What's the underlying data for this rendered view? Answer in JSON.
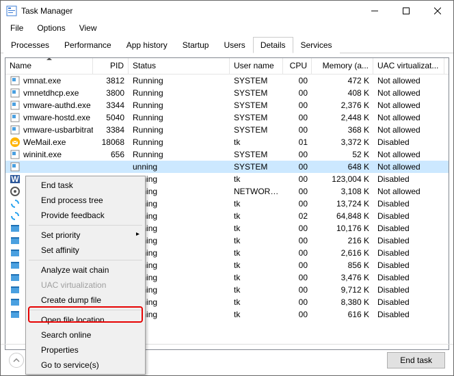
{
  "window": {
    "title": "Task Manager"
  },
  "menu": {
    "file": "File",
    "options": "Options",
    "view": "View"
  },
  "tabs": {
    "items": [
      "Processes",
      "Performance",
      "App history",
      "Startup",
      "Users",
      "Details",
      "Services"
    ],
    "active": 5
  },
  "columns": {
    "name": "Name",
    "pid": "PID",
    "status": "Status",
    "user": "User name",
    "cpu": "CPU",
    "mem": "Memory (a...",
    "uac": "UAC virtualizat..."
  },
  "rows": [
    {
      "icon": "exe",
      "name": "vmnat.exe",
      "pid": "3812",
      "status": "Running",
      "user": "SYSTEM",
      "cpu": "00",
      "mem": "472 K",
      "uac": "Not allowed",
      "sel": false
    },
    {
      "icon": "exe",
      "name": "vmnetdhcp.exe",
      "pid": "3800",
      "status": "Running",
      "user": "SYSTEM",
      "cpu": "00",
      "mem": "408 K",
      "uac": "Not allowed",
      "sel": false
    },
    {
      "icon": "exe",
      "name": "vmware-authd.exe",
      "pid": "3344",
      "status": "Running",
      "user": "SYSTEM",
      "cpu": "00",
      "mem": "2,376 K",
      "uac": "Not allowed",
      "sel": false
    },
    {
      "icon": "exe",
      "name": "vmware-hostd.exe",
      "pid": "5040",
      "status": "Running",
      "user": "SYSTEM",
      "cpu": "00",
      "mem": "2,448 K",
      "uac": "Not allowed",
      "sel": false
    },
    {
      "icon": "exe",
      "name": "vmware-usbarbitrat...",
      "pid": "3384",
      "status": "Running",
      "user": "SYSTEM",
      "cpu": "00",
      "mem": "368 K",
      "uac": "Not allowed",
      "sel": false
    },
    {
      "icon": "wemail",
      "name": "WeMail.exe",
      "pid": "18068",
      "status": "Running",
      "user": "tk",
      "cpu": "01",
      "mem": "3,372 K",
      "uac": "Disabled",
      "sel": false
    },
    {
      "icon": "exe",
      "name": "wininit.exe",
      "pid": "656",
      "status": "Running",
      "user": "SYSTEM",
      "cpu": "00",
      "mem": "52 K",
      "uac": "Not allowed",
      "sel": false
    },
    {
      "icon": "exe",
      "name": "",
      "pid": "",
      "status": "unning",
      "user": "SYSTEM",
      "cpu": "00",
      "mem": "648 K",
      "uac": "Not allowed",
      "sel": true
    },
    {
      "icon": "word",
      "name": "",
      "pid": "",
      "status": "unning",
      "user": "tk",
      "cpu": "00",
      "mem": "123,004 K",
      "uac": "Disabled",
      "sel": false
    },
    {
      "icon": "svc",
      "name": "",
      "pid": "",
      "status": "unning",
      "user": "NETWORK...",
      "cpu": "00",
      "mem": "3,108 K",
      "uac": "Not allowed",
      "sel": false
    },
    {
      "icon": "sync",
      "name": "",
      "pid": "",
      "status": "unning",
      "user": "tk",
      "cpu": "00",
      "mem": "13,724 K",
      "uac": "Disabled",
      "sel": false
    },
    {
      "icon": "sync",
      "name": "",
      "pid": "",
      "status": "unning",
      "user": "tk",
      "cpu": "02",
      "mem": "64,848 K",
      "uac": "Disabled",
      "sel": false
    },
    {
      "icon": "win",
      "name": "",
      "pid": "",
      "status": "unning",
      "user": "tk",
      "cpu": "00",
      "mem": "10,176 K",
      "uac": "Disabled",
      "sel": false
    },
    {
      "icon": "win",
      "name": "",
      "pid": "",
      "status": "unning",
      "user": "tk",
      "cpu": "00",
      "mem": "216 K",
      "uac": "Disabled",
      "sel": false
    },
    {
      "icon": "win",
      "name": "",
      "pid": "",
      "status": "unning",
      "user": "tk",
      "cpu": "00",
      "mem": "2,616 K",
      "uac": "Disabled",
      "sel": false
    },
    {
      "icon": "win",
      "name": "",
      "pid": "",
      "status": "unning",
      "user": "tk",
      "cpu": "00",
      "mem": "856 K",
      "uac": "Disabled",
      "sel": false
    },
    {
      "icon": "win",
      "name": "",
      "pid": "",
      "status": "unning",
      "user": "tk",
      "cpu": "00",
      "mem": "3,476 K",
      "uac": "Disabled",
      "sel": false
    },
    {
      "icon": "win",
      "name": "",
      "pid": "",
      "status": "unning",
      "user": "tk",
      "cpu": "00",
      "mem": "9,712 K",
      "uac": "Disabled",
      "sel": false
    },
    {
      "icon": "win",
      "name": "",
      "pid": "",
      "status": "unning",
      "user": "tk",
      "cpu": "00",
      "mem": "8,380 K",
      "uac": "Disabled",
      "sel": false
    },
    {
      "icon": "win",
      "name": "",
      "pid": "",
      "status": "unning",
      "user": "tk",
      "cpu": "00",
      "mem": "616 K",
      "uac": "Disabled",
      "sel": false
    }
  ],
  "context_menu": {
    "end_task": "End task",
    "end_tree": "End process tree",
    "feedback": "Provide feedback",
    "set_priority": "Set priority",
    "set_affinity": "Set affinity",
    "analyze": "Analyze wait chain",
    "uac": "UAC virtualization",
    "dump": "Create dump file",
    "open_loc": "Open file location",
    "search": "Search online",
    "props": "Properties",
    "goto": "Go to service(s)"
  },
  "bottom": {
    "end_task": "End task"
  },
  "icons": {
    "exe": "generic-executable-icon",
    "wemail": "wemail-app-icon",
    "word": "winword-icon",
    "svc": "service-icon",
    "sync": "sync-app-icon",
    "win": "window-app-icon"
  }
}
